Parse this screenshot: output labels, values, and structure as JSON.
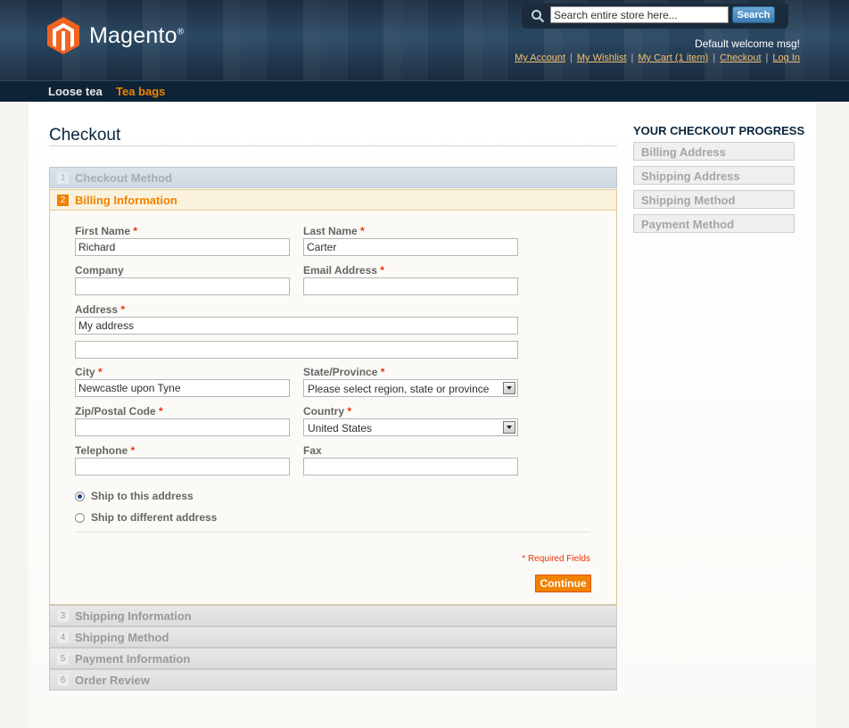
{
  "header": {
    "logo_text": "Magento",
    "logo_mark": "®",
    "search_placeholder": "Search entire store here...",
    "search_button": "Search",
    "welcome": "Default welcome msg!",
    "links": [
      "My Account",
      "My Wishlist",
      "My Cart (1 item)",
      "Checkout",
      "Log In"
    ]
  },
  "nav": {
    "items": [
      "Loose tea",
      "Tea bags"
    ],
    "active": "Tea bags"
  },
  "page": {
    "title": "Checkout"
  },
  "steps": [
    {
      "num": "1",
      "label": "Checkout Method"
    },
    {
      "num": "2",
      "label": "Billing Information"
    },
    {
      "num": "3",
      "label": "Shipping Information"
    },
    {
      "num": "4",
      "label": "Shipping Method"
    },
    {
      "num": "5",
      "label": "Payment Information"
    },
    {
      "num": "6",
      "label": "Order Review"
    }
  ],
  "form": {
    "first_name_label": "First Name",
    "first_name_value": "Richard",
    "last_name_label": "Last Name",
    "last_name_value": "Carter",
    "company_label": "Company",
    "company_value": "",
    "email_label": "Email Address",
    "email_value": "",
    "address_label": "Address",
    "address_value_1": "My address",
    "address_value_2": "",
    "city_label": "City",
    "city_value": "Newcastle upon Tyne",
    "state_label": "State/Province",
    "state_value": "Please select region, state or province",
    "zip_label": "Zip/Postal Code",
    "zip_value": "",
    "country_label": "Country",
    "country_value": "United States",
    "telephone_label": "Telephone",
    "telephone_value": "",
    "fax_label": "Fax",
    "fax_value": "",
    "required_mark": "*",
    "ship_same": "Ship to this address",
    "ship_different": "Ship to different address",
    "required_note": "* Required Fields",
    "continue": "Continue"
  },
  "progress": {
    "title": "YOUR CHECKOUT PROGRESS",
    "items": [
      "Billing Address",
      "Shipping Address",
      "Shipping Method",
      "Payment Method"
    ]
  },
  "colors": {
    "accent": "#f18200",
    "header_dark": "#1d2f42",
    "link": "#f4c06f",
    "required": "#eb340a"
  }
}
